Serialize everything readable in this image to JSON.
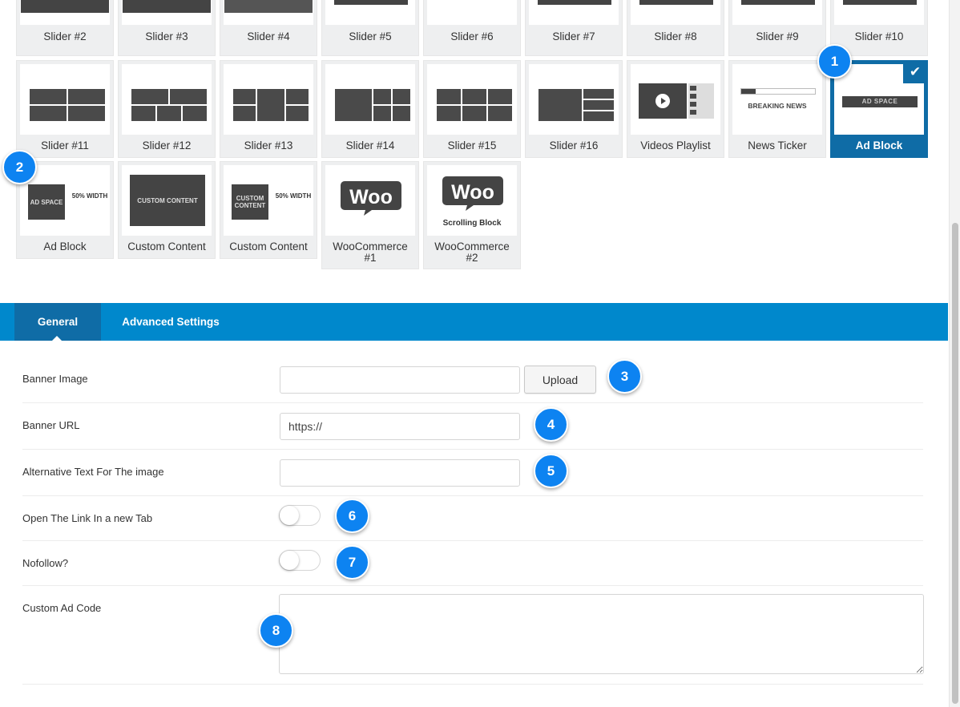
{
  "blocks": {
    "row0": [
      "Slider #2",
      "Slider #3",
      "Slider #4",
      "Slider #5",
      "Slider #6",
      "Slider #7",
      "Slider #8",
      "Slider #9",
      "Slider #10"
    ],
    "row1": [
      "Slider #11",
      "Slider #12",
      "Slider #13",
      "Slider #14",
      "Slider #15",
      "Slider #16",
      "Videos Playlist",
      "News Ticker",
      "Ad Block"
    ],
    "row2": [
      "Ad Block",
      "Custom Content",
      "Custom Content",
      "WooCommerce #1",
      "WooCommerce #2"
    ],
    "selected_label": "Ad Block",
    "thumb_text": {
      "ad_space": "AD SPACE",
      "width_50": "50% WIDTH",
      "custom_content": "CUSTOM CONTENT",
      "breaking_news": "BREAKING NEWS",
      "woo": "Woo",
      "scrolling_block": "Scrolling Block"
    }
  },
  "tabs": [
    {
      "label": "General",
      "active": true
    },
    {
      "label": "Advanced Settings",
      "active": false
    }
  ],
  "form": {
    "banner_image": {
      "label": "Banner Image",
      "value": "",
      "button": "Upload"
    },
    "banner_url": {
      "label": "Banner URL",
      "value": "https://"
    },
    "alt_text": {
      "label": "Alternative Text For The image",
      "value": ""
    },
    "new_tab": {
      "label": "Open The Link In a new Tab",
      "on": false
    },
    "nofollow": {
      "label": "Nofollow?",
      "on": false
    },
    "custom_code": {
      "label": "Custom Ad Code",
      "value": ""
    }
  },
  "badges": [
    "1",
    "2",
    "3",
    "4",
    "5",
    "6",
    "7",
    "8"
  ],
  "colors": {
    "accent": "#0088cc",
    "selected": "#0f6ca6",
    "badge": "#0d83f1",
    "tile_bg": "#eeeff0",
    "thumb_dark": "#444444"
  },
  "icons": {
    "selected": "checkmark-icon",
    "video": "play-icon",
    "woo": "woo-logo"
  }
}
